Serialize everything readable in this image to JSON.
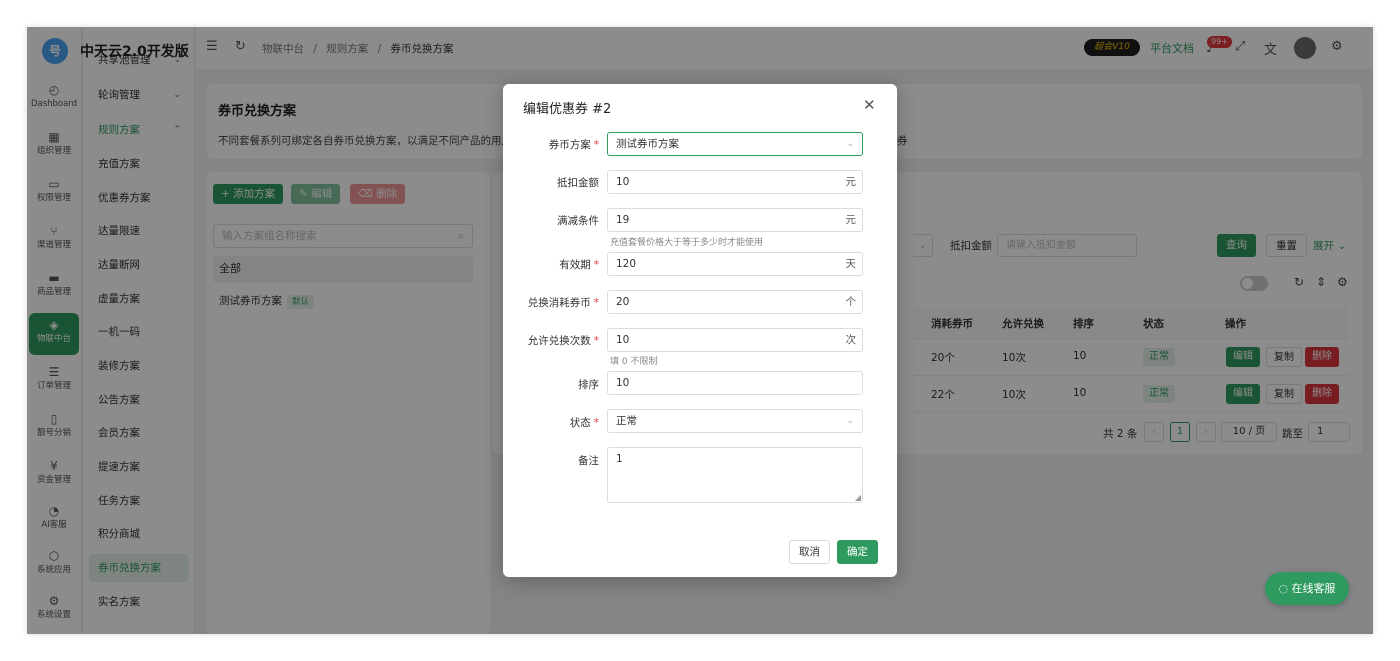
{
  "app": {
    "logo_text": "号",
    "brand": "中天云2.0开发版"
  },
  "rail": [
    {
      "icon": "◴",
      "label": "Dashboard",
      "name": "dashboard"
    },
    {
      "icon": "▦",
      "label": "组织管理",
      "name": "org"
    },
    {
      "icon": "▭",
      "label": "权限管理",
      "name": "permission"
    },
    {
      "icon": "⑂",
      "label": "渠道管理",
      "name": "channel"
    },
    {
      "icon": "▬",
      "label": "商品管理",
      "name": "goods"
    },
    {
      "icon": "◈",
      "label": "物联中台",
      "name": "iot"
    },
    {
      "icon": "☰",
      "label": "订单管理",
      "name": "order"
    },
    {
      "icon": "▯",
      "label": "靓号分销",
      "name": "number"
    },
    {
      "icon": "¥",
      "label": "资金管理",
      "name": "fund"
    },
    {
      "icon": "◔",
      "label": "AI客服",
      "name": "ai-service"
    },
    {
      "icon": "⬡",
      "label": "系统应用",
      "name": "apps"
    },
    {
      "icon": "⚙",
      "label": "系统设置",
      "name": "settings"
    }
  ],
  "submenu": [
    {
      "label": "共享池管理",
      "chev": "⌄"
    },
    {
      "label": "轮询管理",
      "chev": "⌄"
    },
    {
      "label": "规则方案",
      "chev": "⌃"
    },
    {
      "label": "充值方案",
      "chev": ""
    },
    {
      "label": "优惠券方案",
      "chev": ""
    },
    {
      "label": "达量限速",
      "chev": ""
    },
    {
      "label": "达量断网",
      "chev": ""
    },
    {
      "label": "虚量方案",
      "chev": ""
    },
    {
      "label": "一机一码",
      "chev": ""
    },
    {
      "label": "装修方案",
      "chev": ""
    },
    {
      "label": "公告方案",
      "chev": ""
    },
    {
      "label": "会员方案",
      "chev": ""
    },
    {
      "label": "提速方案",
      "chev": ""
    },
    {
      "label": "任务方案",
      "chev": ""
    },
    {
      "label": "积分商城",
      "chev": ""
    },
    {
      "label": "券币兑换方案",
      "chev": ""
    },
    {
      "label": "实名方案",
      "chev": ""
    }
  ],
  "header": {
    "breadcrumb": [
      "物联中台",
      "规则方案",
      "券币兑换方案"
    ],
    "separator": "/",
    "vip_label": "超会V10",
    "docs_link": "平台文档",
    "notif_count": "99+"
  },
  "page": {
    "title": "券币兑换方案",
    "desc_left": "不同套餐系列可绑定各自券币兑换方案，以满足不同产品的用户运",
    "desc_right": "券"
  },
  "left_panel": {
    "add_btn": "+ 添加方案",
    "edit_btn": "✎ 编辑",
    "delete_btn": "⌫ 删除",
    "search_placeholder": "输入方案组名称搜索",
    "all_label": "全部",
    "scheme_name": "测试券币方案",
    "scheme_tag": "默认"
  },
  "filter": {
    "amount_label": "抵扣金额",
    "amount_placeholder": "请输入抵扣金额",
    "query_btn": "查询",
    "reset_btn": "重置",
    "expand_label": "展开 ⌄"
  },
  "table": {
    "headers": [
      "消耗券币",
      "允许兑换",
      "排序",
      "状态",
      "操作"
    ],
    "rows": [
      {
        "cost": "20个",
        "times": "10次",
        "sort": "10",
        "status": "正常"
      },
      {
        "cost": "22个",
        "times": "10次",
        "sort": "10",
        "status": "正常"
      }
    ],
    "actions": {
      "edit": "编辑",
      "copy": "复制",
      "delete": "删除"
    }
  },
  "pagination": {
    "total": "共 2 条",
    "prev": "‹",
    "current": "1",
    "next": "›",
    "page_size": "10 / 页",
    "jump_label": "跳至",
    "jump_value": "1"
  },
  "online_service": "在线客服",
  "dialog": {
    "title": "编辑优惠券 #2",
    "fields": {
      "scheme": {
        "label": "券币方案",
        "value": "测试券币方案"
      },
      "amount": {
        "label": "抵扣金额",
        "value": "10",
        "unit": "元"
      },
      "threshold": {
        "label": "满减条件",
        "value": "19",
        "unit": "元",
        "hint": "充值套餐价格大于等于多少时才能使用"
      },
      "validity": {
        "label": "有效期",
        "value": "120",
        "unit": "天"
      },
      "cost": {
        "label": "兑换消耗券币",
        "value": "20",
        "unit": "个"
      },
      "times": {
        "label": "允许兑换次数",
        "value": "10",
        "unit": "次",
        "hint": "填 0 不限制"
      },
      "sort": {
        "label": "排序",
        "value": "10"
      },
      "status": {
        "label": "状态",
        "value": "正常"
      },
      "remark": {
        "label": "备注",
        "value": "1"
      }
    },
    "required_mark": "*",
    "cancel": "取消",
    "confirm": "确定"
  },
  "colors": {
    "primary": "#2e9a5f",
    "danger": "#e0393e",
    "mask": "rgba(0,0,0,0.45)"
  }
}
